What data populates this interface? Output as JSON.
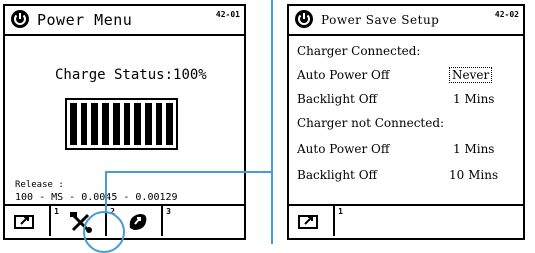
{
  "left_screen": {
    "title": "Power Menu",
    "code": "42-01",
    "charge_label": "Charge Status:",
    "charge_value": "100%",
    "battery_level": 1.0,
    "release_label": "Release :",
    "release_value": "100 - MS - 0.0045 - 0.00129",
    "softkeys": [
      {
        "icon": "battery-charge-icon",
        "number": "1"
      },
      {
        "icon": "tools-icon",
        "number": "2"
      },
      {
        "icon": "power-save-icon",
        "number": "3"
      }
    ]
  },
  "right_screen": {
    "title": "Power Save Setup",
    "code": "42-02",
    "sections": [
      {
        "heading": "Charger Connected:",
        "rows": [
          {
            "label": "Auto Power Off",
            "value": "Never"
          },
          {
            "label": "Backlight Off",
            "value": "1 Mins"
          }
        ]
      },
      {
        "heading": "Charger not Connected:",
        "rows": [
          {
            "label": "Auto Power Off",
            "value": "1 Mins"
          },
          {
            "label": "Backlight Off",
            "value": "10 Mins"
          }
        ]
      }
    ],
    "softkeys": [
      {
        "icon": "battery-charge-icon",
        "number": "1"
      }
    ]
  },
  "colors": {
    "callout": "#4a9cd6",
    "ink": "#000000",
    "background": "#ffffff"
  }
}
